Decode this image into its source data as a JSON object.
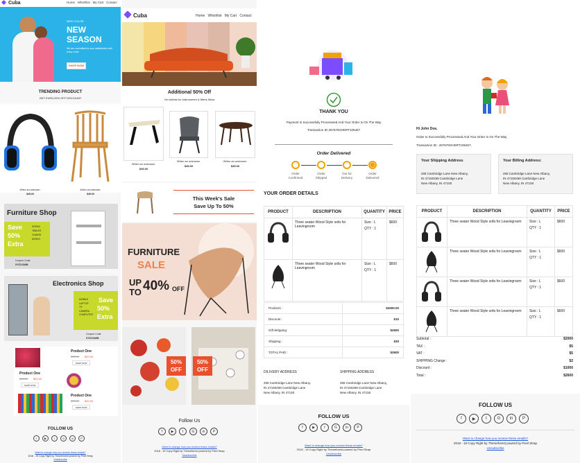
{
  "colors": {
    "accent": "#2bb3e8",
    "purple": "#7c4dff",
    "orange": "#f0a300",
    "lime": "#c8d92b",
    "red": "#e9502c",
    "link": "#1a53d6"
  },
  "p1": {
    "brand": "Cuba",
    "nav": [
      "Home",
      "Whishlist",
      "My Cart",
      "Contact"
    ],
    "hero": {
      "small": "NEW COLOR",
      "big1": "NEW",
      "big2": "SEASON",
      "sub": "We are committed to your satisfaction with every order",
      "button": "SHOP NOW"
    },
    "trending_title": "TRENDING PRODUCT",
    "trending_sub": "GET EVEN 20% OFF DISCOUNT",
    "trending_items": [
      {
        "name": "When an unknown.",
        "price": "$45.00"
      },
      {
        "name": "When an unknown.",
        "price": "$45.00"
      }
    ],
    "furniture": {
      "title": "Furniture Shop",
      "save1": "Save",
      "save2": "50%",
      "save3": "Extra",
      "list": [
        "SOFAS",
        "TABLES",
        "CHAIRS",
        "DESKS"
      ],
      "coupon": "Coupon Code",
      "code": "XYZ123456"
    },
    "electronics": {
      "title": "Electronics Shop",
      "save1": "Save",
      "save2": "50%",
      "save3": "Extra",
      "list": [
        "MOBILE",
        "LAPTOP",
        "TV",
        "CAMERA",
        "COMPUTER"
      ],
      "coupon": "Coupon Code",
      "code": "XYZ123456"
    },
    "products": [
      {
        "name": "Product One",
        "old": "$35.00",
        "new": "$20.00",
        "button": "SHOP NOW"
      },
      {
        "name": "Product One",
        "old": "$35.00",
        "new": "$20.00",
        "button": "SHOP NOW"
      },
      {
        "name": "Product One",
        "old": "$35.00",
        "new": "$20.00",
        "button": "SHOP NOW"
      }
    ],
    "follow": "FOLLOW US",
    "change": "Want to change how you receive these emails?",
    "copyright": "2018 - 19 Copy Right by Themeforest powerd by Pixel Strap",
    "unsubscribe": "Unsubscribe"
  },
  "p2": {
    "brand": "Cuba",
    "nav": [
      "Home",
      "Whishlist",
      "My Cart",
      "Contact"
    ],
    "offer": "Additional 50% Off",
    "offer_sub": "On clothes for kids,women & Mens Wear",
    "items": [
      {
        "name": "When an unknown.",
        "price": "$45.00"
      },
      {
        "name": "When an unknown.",
        "price": "$45.00"
      },
      {
        "name": "When an unknown.",
        "price": "$45.00"
      }
    ],
    "weekly1": "This Week's Sale",
    "weekly2": "Save Up To 50%",
    "banner": {
      "l1": "FURNITURE",
      "l2": "SALE",
      "l3": "UP",
      "l4": "TO",
      "l5": "40%",
      "l6": "OFF"
    },
    "badges": [
      {
        "pct": "50%",
        "off": "OFF"
      },
      {
        "pct": "50%",
        "off": "OFF"
      }
    ],
    "follow": "Follow Us",
    "change": "Want to change how you receive these emails?",
    "copyright": "2018 - 19 Copy Right by Themeforest powerd by Pixel Strap",
    "unsubscribe": "Unsubscribe"
  },
  "p3": {
    "thank": "THANK YOU",
    "msg": "Payment Is Successfully Processsed And Your Order Is On The Way",
    "txn": "Transaction ID 267676GHERT105467",
    "delivered": "Order Delivered",
    "steps": [
      {
        "l1": "Order",
        "l2": "Confirmed"
      },
      {
        "l1": "Order",
        "l2": "Shipped"
      },
      {
        "l1": "Out for",
        "l2": "Delivery"
      },
      {
        "l1": "Order",
        "l2": "Delivered"
      }
    ],
    "details": "YOUR ORDER DETAILS",
    "headers": [
      "PRODUCT",
      "DESCRIPTION",
      "QUANTITY",
      "PRICE"
    ],
    "rows": [
      {
        "desc": "Three seater Wood Style sofa for Leavingroom",
        "size": "Size : L",
        "qty": "QTY : 1",
        "price": "$600"
      },
      {
        "desc": "Three seater Wood Style sofa for Leavingroom",
        "size": "Size : L",
        "qty": "QTY : 1",
        "price": "$600"
      }
    ],
    "summary": [
      {
        "k": "Products :",
        "v": "$2600.00"
      },
      {
        "k": "Discount :",
        "v": "$10"
      },
      {
        "k": "Gift Wripping:",
        "v": "$2600"
      },
      {
        "k": "Shipping :",
        "v": "$30"
      },
      {
        "k": "TOTAL PAID :",
        "v": "$2600"
      }
    ],
    "delivery_title": "DILIVERY ADDRESS",
    "shipping_title": "SHIPPING ADDRESS",
    "address": [
      "268 Cambridge Lane New Albany,",
      "IN 47150268 Cambridge Lane",
      "New Albany, IN 47150"
    ],
    "follow": "FOLLOW US",
    "change": "Want to change how you receive these emails?",
    "copyright": "2018 - 19 Copy Right by Themeforest powerd by Pixel Strap",
    "unsubscribe": "Unsubscribe"
  },
  "p4": {
    "greeting": "Hi John Doe,",
    "msg": "Order Is Successfully Processsed And Your Order Is On The Way,",
    "txn": "Transaction ID : 267676GHERT105467,",
    "ship_title": "Your Shipping Address",
    "bill_title": "Your Billing Address:",
    "address": [
      "268 Cambridge Lane New Albany,",
      "IN 47150268 Cambridge Lane",
      "New Albany, IN 47150"
    ],
    "headers": [
      "PRODUCT",
      "DESCRIPTION",
      "QUANTITY",
      "PRICE"
    ],
    "rows": [
      {
        "desc": "Three seater Wood Style sofa for Leavingroom",
        "size": "Size : L",
        "qty": "QTY : 1",
        "price": "$600"
      },
      {
        "desc": "Three seater Wood Style sofa for Leavingroom",
        "size": "Size : L",
        "qty": "QTY : 1",
        "price": "$600"
      },
      {
        "desc": "Three seater Wood Style sofa for Leavingroom",
        "size": "Size : L",
        "qty": "QTY : 1",
        "price": "$600"
      },
      {
        "desc": "Three seater Wood Style sofa for Leavingroom",
        "size": "Size : L",
        "qty": "QTY : 1",
        "price": "$600"
      }
    ],
    "summary": [
      {
        "k": "Subtotal :",
        "v": "$2000"
      },
      {
        "k": "TAX :",
        "v": "$5"
      },
      {
        "k": "VAT :",
        "v": "$5"
      },
      {
        "k": "SHIPPING Charge :",
        "v": "$2"
      },
      {
        "k": "Discount :",
        "v": "$1000"
      },
      {
        "k": "Total :",
        "v": "$2600"
      }
    ],
    "follow": "FOLLOW US",
    "change": "Want to change how you receive these emails?",
    "copyright": "2018 - 19 Copy Right by Themeforest powerd by Pixel Strap",
    "unsubscribe": "Unsubscribe"
  }
}
